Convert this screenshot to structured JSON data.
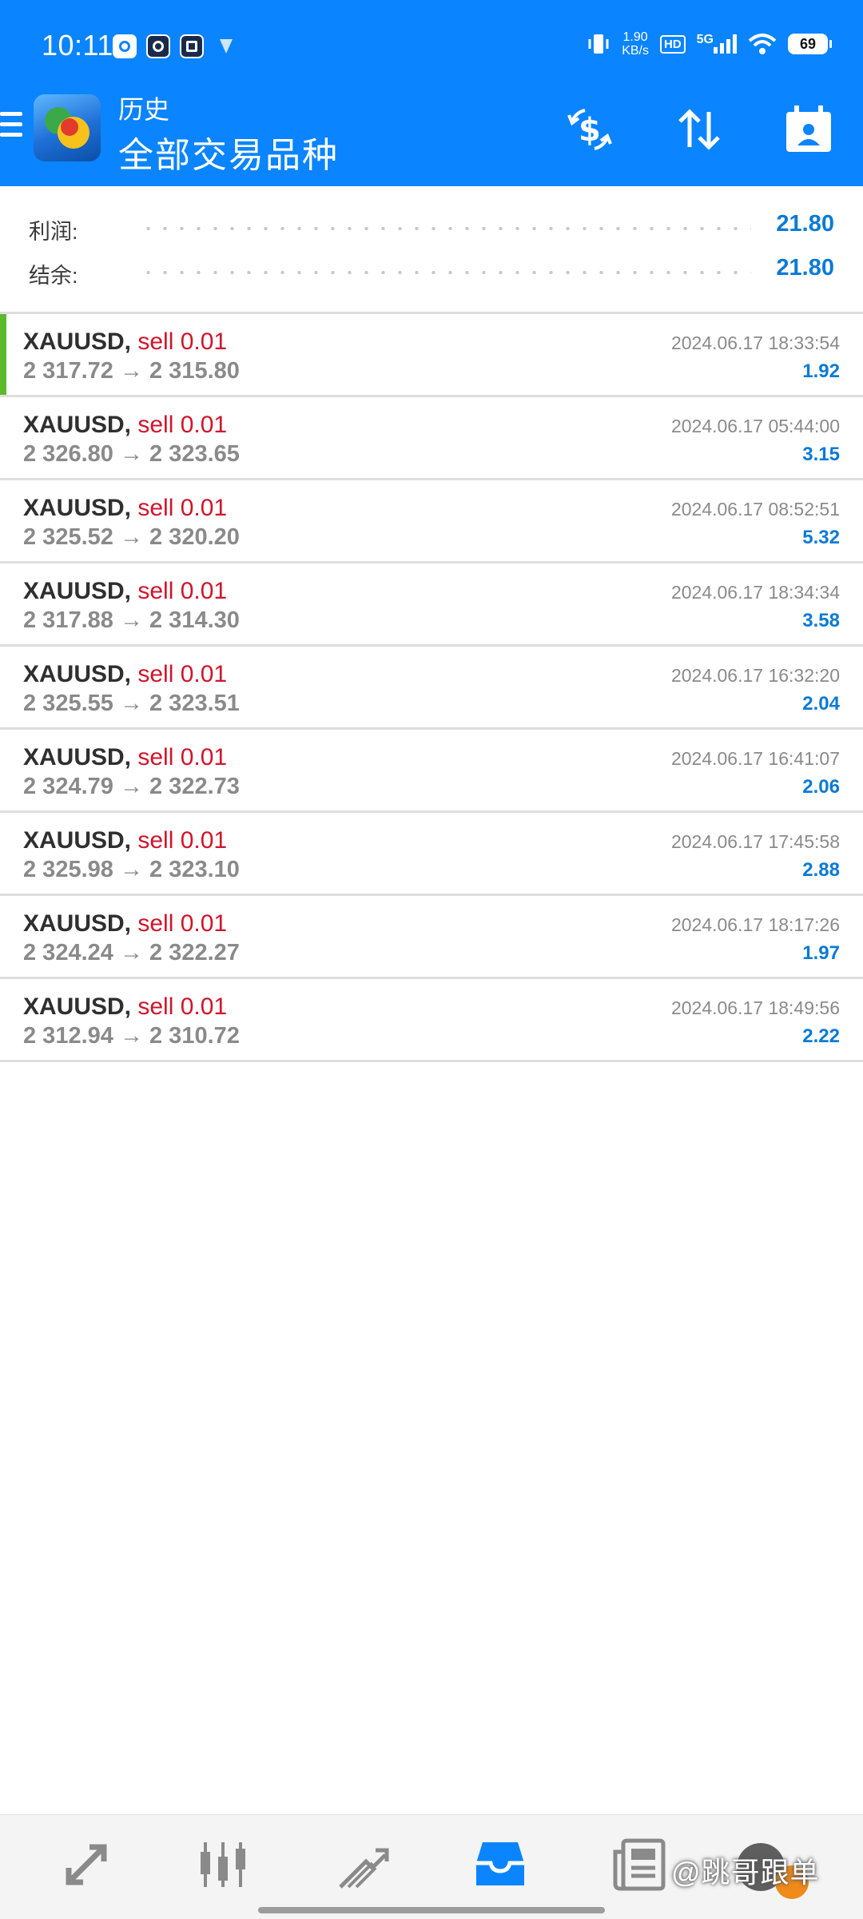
{
  "status_bar": {
    "time": "10:11",
    "net_speed_value": "1.90",
    "net_speed_unit": "KB/s",
    "hd_label": "HD",
    "network_type": "5G",
    "battery": "69"
  },
  "header": {
    "subtitle": "历史",
    "title": "全部交易品种"
  },
  "summary": {
    "profit_label": "利润:",
    "profit_value": "21.80",
    "balance_label": "结余:",
    "balance_value": "21.80"
  },
  "trades": [
    {
      "symbol": "XAUUSD,",
      "side": "sell 0.01",
      "prices": "2 317.72 → 2 315.80",
      "datetime": "2024.06.17 18:33:54",
      "profit": "1.92"
    },
    {
      "symbol": "XAUUSD,",
      "side": "sell 0.01",
      "prices": "2 326.80 → 2 323.65",
      "datetime": "2024.06.17 05:44:00",
      "profit": "3.15"
    },
    {
      "symbol": "XAUUSD,",
      "side": "sell 0.01",
      "prices": "2 325.52 → 2 320.20",
      "datetime": "2024.06.17 08:52:51",
      "profit": "5.32"
    },
    {
      "symbol": "XAUUSD,",
      "side": "sell 0.01",
      "prices": "2 317.88 → 2 314.30",
      "datetime": "2024.06.17 18:34:34",
      "profit": "3.58"
    },
    {
      "symbol": "XAUUSD,",
      "side": "sell 0.01",
      "prices": "2 325.55 → 2 323.51",
      "datetime": "2024.06.17 16:32:20",
      "profit": "2.04"
    },
    {
      "symbol": "XAUUSD,",
      "side": "sell 0.01",
      "prices": "2 324.79 → 2 322.73",
      "datetime": "2024.06.17 16:41:07",
      "profit": "2.06"
    },
    {
      "symbol": "XAUUSD,",
      "side": "sell 0.01",
      "prices": "2 325.98 → 2 323.10",
      "datetime": "2024.06.17 17:45:58",
      "profit": "2.88"
    },
    {
      "symbol": "XAUUSD,",
      "side": "sell 0.01",
      "prices": "2 324.24 → 2 322.27",
      "datetime": "2024.06.17 18:17:26",
      "profit": "1.97"
    },
    {
      "symbol": "XAUUSD,",
      "side": "sell 0.01",
      "prices": "2 312.94 → 2 310.72",
      "datetime": "2024.06.17 18:49:56",
      "profit": "2.22"
    }
  ],
  "bottom_nav": [
    {
      "icon": "quotes-icon",
      "active": false
    },
    {
      "icon": "chart-icon",
      "active": false
    },
    {
      "icon": "trade-icon",
      "active": false
    },
    {
      "icon": "history-icon",
      "active": true
    },
    {
      "icon": "news-icon",
      "active": false
    }
  ],
  "watermark": "@跳哥跟单",
  "colors": {
    "header_bg": "#0a84ff",
    "profit_blue": "#0a7ad6",
    "sell_red": "#d0152b",
    "active_bar": "#5aba2a",
    "nav_active": "#0a84ff",
    "nav_inactive": "#8a8a8a"
  }
}
